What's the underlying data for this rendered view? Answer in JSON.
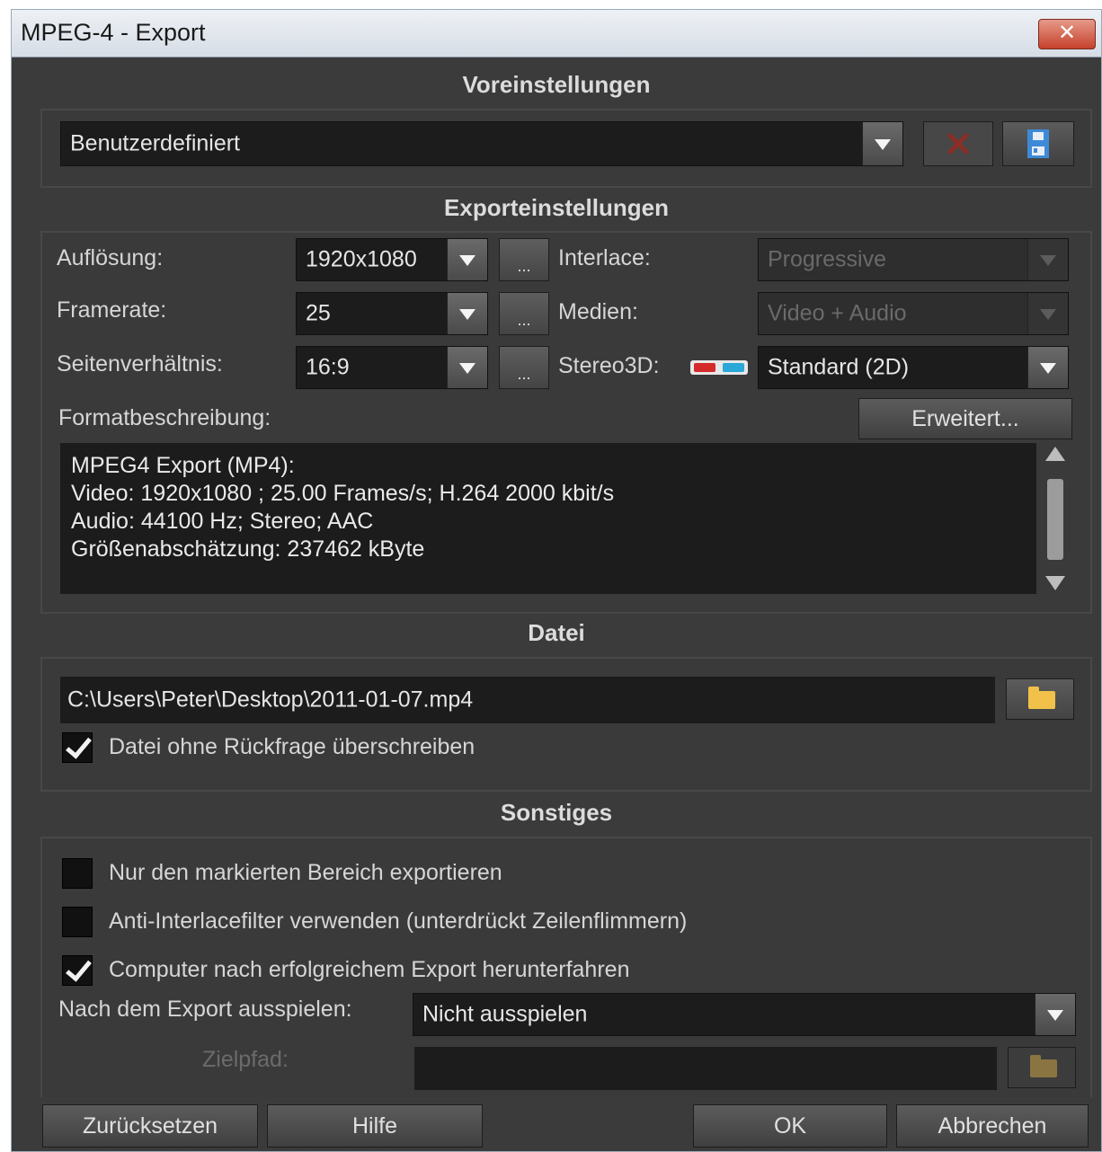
{
  "window": {
    "title": "MPEG-4 - Export",
    "close_label": "✕"
  },
  "presets": {
    "section_title": "Voreinstellungen",
    "selected": "Benutzerdefiniert",
    "delete_icon": "delete-x-icon",
    "save_icon": "save-disk-icon"
  },
  "export_settings": {
    "section_title": "Exporteinstellungen",
    "resolution_label": "Auflösung:",
    "resolution_value": "1920x1080",
    "framerate_label": "Framerate:",
    "framerate_value": "25",
    "aspect_label": "Seitenverhältnis:",
    "aspect_value": "16:9",
    "more_label": "...",
    "interlace_label": "Interlace:",
    "interlace_value": "Progressive",
    "media_label": "Medien:",
    "media_value": "Video + Audio",
    "stereo_label": "Stereo3D:",
    "stereo_value": "Standard (2D)",
    "format_label": "Formatbeschreibung:",
    "advanced_button": "Erweitert...",
    "description_lines": [
      "MPEG4 Export (MP4):",
      "Video: 1920x1080 ; 25.00 Frames/s; H.264 2000 kbit/s",
      "Audio: 44100 Hz; Stereo;  AAC",
      "Größenabschätzung: 237462 kByte"
    ]
  },
  "file": {
    "section_title": "Datei",
    "path": "C:\\Users\\Peter\\Desktop\\2011-01-07.mp4",
    "overwrite_label": "Datei ohne Rückfrage überschreiben",
    "overwrite_checked": true
  },
  "misc": {
    "section_title": "Sonstiges",
    "only_marked_label": "Nur den markierten Bereich exportieren",
    "only_marked_checked": false,
    "anti_interlace_label": "Anti-Interlacefilter verwenden (unterdrückt Zeilenflimmern)",
    "anti_interlace_checked": false,
    "shutdown_label": "Computer nach erfolgreichem Export herunterfahren",
    "shutdown_checked": true,
    "playout_label": "Nach dem Export ausspielen:",
    "playout_value": "Nicht ausspielen",
    "target_label": "Zielpfad:"
  },
  "buttons": {
    "reset": "Zurücksetzen",
    "help": "Hilfe",
    "ok": "OK",
    "cancel": "Abbrechen"
  }
}
